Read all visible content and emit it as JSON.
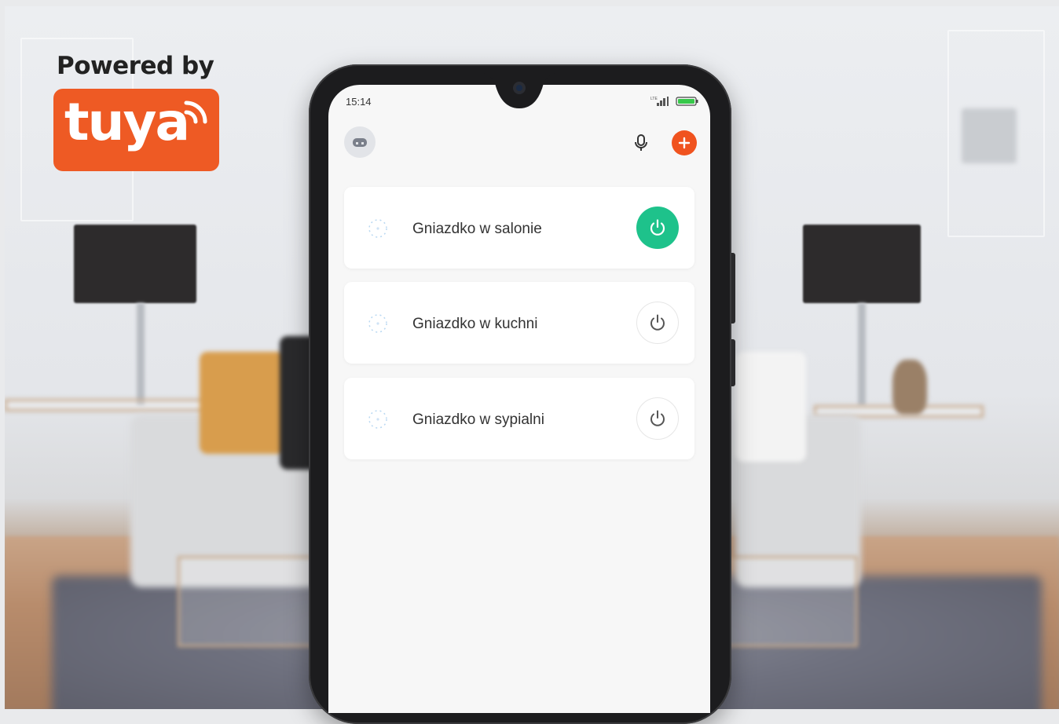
{
  "branding": {
    "powered_by": "Powered by",
    "logo_text": "tuya",
    "logo_color": "#ee5a24"
  },
  "status_bar": {
    "time": "15:14",
    "icons": [
      "signal-icon",
      "battery-icon"
    ]
  },
  "header": {
    "icons": [
      "avatar-icon",
      "microphone-icon",
      "add-icon"
    ],
    "add_color": "#f0531f"
  },
  "devices": [
    {
      "name": "Gniazdko w salonie",
      "state": "on"
    },
    {
      "name": "Gniazdko w kuchni",
      "state": "off"
    },
    {
      "name": "Gniazdko w sypialni",
      "state": "off"
    }
  ],
  "colors": {
    "power_on": "#1ec28b",
    "power_off_icon": "#555555"
  }
}
